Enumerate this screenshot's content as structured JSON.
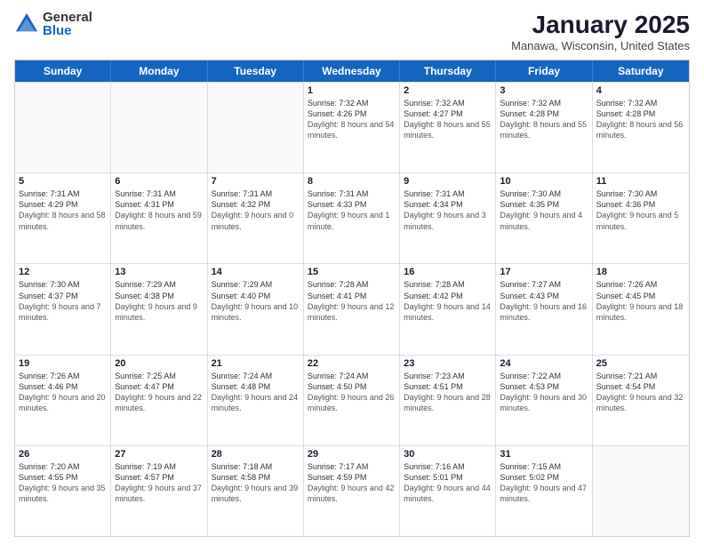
{
  "logo": {
    "general": "General",
    "blue": "Blue"
  },
  "header": {
    "month": "January 2025",
    "location": "Manawa, Wisconsin, United States"
  },
  "weekdays": [
    "Sunday",
    "Monday",
    "Tuesday",
    "Wednesday",
    "Thursday",
    "Friday",
    "Saturday"
  ],
  "rows": [
    [
      {
        "day": "",
        "sunrise": "",
        "sunset": "",
        "daylight": ""
      },
      {
        "day": "",
        "sunrise": "",
        "sunset": "",
        "daylight": ""
      },
      {
        "day": "",
        "sunrise": "",
        "sunset": "",
        "daylight": ""
      },
      {
        "day": "1",
        "sunrise": "Sunrise: 7:32 AM",
        "sunset": "Sunset: 4:26 PM",
        "daylight": "Daylight: 8 hours and 54 minutes."
      },
      {
        "day": "2",
        "sunrise": "Sunrise: 7:32 AM",
        "sunset": "Sunset: 4:27 PM",
        "daylight": "Daylight: 8 hours and 55 minutes."
      },
      {
        "day": "3",
        "sunrise": "Sunrise: 7:32 AM",
        "sunset": "Sunset: 4:28 PM",
        "daylight": "Daylight: 8 hours and 55 minutes."
      },
      {
        "day": "4",
        "sunrise": "Sunrise: 7:32 AM",
        "sunset": "Sunset: 4:28 PM",
        "daylight": "Daylight: 8 hours and 56 minutes."
      }
    ],
    [
      {
        "day": "5",
        "sunrise": "Sunrise: 7:31 AM",
        "sunset": "Sunset: 4:29 PM",
        "daylight": "Daylight: 8 hours and 58 minutes."
      },
      {
        "day": "6",
        "sunrise": "Sunrise: 7:31 AM",
        "sunset": "Sunset: 4:31 PM",
        "daylight": "Daylight: 8 hours and 59 minutes."
      },
      {
        "day": "7",
        "sunrise": "Sunrise: 7:31 AM",
        "sunset": "Sunset: 4:32 PM",
        "daylight": "Daylight: 9 hours and 0 minutes."
      },
      {
        "day": "8",
        "sunrise": "Sunrise: 7:31 AM",
        "sunset": "Sunset: 4:33 PM",
        "daylight": "Daylight: 9 hours and 1 minute."
      },
      {
        "day": "9",
        "sunrise": "Sunrise: 7:31 AM",
        "sunset": "Sunset: 4:34 PM",
        "daylight": "Daylight: 9 hours and 3 minutes."
      },
      {
        "day": "10",
        "sunrise": "Sunrise: 7:30 AM",
        "sunset": "Sunset: 4:35 PM",
        "daylight": "Daylight: 9 hours and 4 minutes."
      },
      {
        "day": "11",
        "sunrise": "Sunrise: 7:30 AM",
        "sunset": "Sunset: 4:36 PM",
        "daylight": "Daylight: 9 hours and 5 minutes."
      }
    ],
    [
      {
        "day": "12",
        "sunrise": "Sunrise: 7:30 AM",
        "sunset": "Sunset: 4:37 PM",
        "daylight": "Daylight: 9 hours and 7 minutes."
      },
      {
        "day": "13",
        "sunrise": "Sunrise: 7:29 AM",
        "sunset": "Sunset: 4:38 PM",
        "daylight": "Daylight: 9 hours and 9 minutes."
      },
      {
        "day": "14",
        "sunrise": "Sunrise: 7:29 AM",
        "sunset": "Sunset: 4:40 PM",
        "daylight": "Daylight: 9 hours and 10 minutes."
      },
      {
        "day": "15",
        "sunrise": "Sunrise: 7:28 AM",
        "sunset": "Sunset: 4:41 PM",
        "daylight": "Daylight: 9 hours and 12 minutes."
      },
      {
        "day": "16",
        "sunrise": "Sunrise: 7:28 AM",
        "sunset": "Sunset: 4:42 PM",
        "daylight": "Daylight: 9 hours and 14 minutes."
      },
      {
        "day": "17",
        "sunrise": "Sunrise: 7:27 AM",
        "sunset": "Sunset: 4:43 PM",
        "daylight": "Daylight: 9 hours and 16 minutes."
      },
      {
        "day": "18",
        "sunrise": "Sunrise: 7:26 AM",
        "sunset": "Sunset: 4:45 PM",
        "daylight": "Daylight: 9 hours and 18 minutes."
      }
    ],
    [
      {
        "day": "19",
        "sunrise": "Sunrise: 7:26 AM",
        "sunset": "Sunset: 4:46 PM",
        "daylight": "Daylight: 9 hours and 20 minutes."
      },
      {
        "day": "20",
        "sunrise": "Sunrise: 7:25 AM",
        "sunset": "Sunset: 4:47 PM",
        "daylight": "Daylight: 9 hours and 22 minutes."
      },
      {
        "day": "21",
        "sunrise": "Sunrise: 7:24 AM",
        "sunset": "Sunset: 4:48 PM",
        "daylight": "Daylight: 9 hours and 24 minutes."
      },
      {
        "day": "22",
        "sunrise": "Sunrise: 7:24 AM",
        "sunset": "Sunset: 4:50 PM",
        "daylight": "Daylight: 9 hours and 26 minutes."
      },
      {
        "day": "23",
        "sunrise": "Sunrise: 7:23 AM",
        "sunset": "Sunset: 4:51 PM",
        "daylight": "Daylight: 9 hours and 28 minutes."
      },
      {
        "day": "24",
        "sunrise": "Sunrise: 7:22 AM",
        "sunset": "Sunset: 4:53 PM",
        "daylight": "Daylight: 9 hours and 30 minutes."
      },
      {
        "day": "25",
        "sunrise": "Sunrise: 7:21 AM",
        "sunset": "Sunset: 4:54 PM",
        "daylight": "Daylight: 9 hours and 32 minutes."
      }
    ],
    [
      {
        "day": "26",
        "sunrise": "Sunrise: 7:20 AM",
        "sunset": "Sunset: 4:55 PM",
        "daylight": "Daylight: 9 hours and 35 minutes."
      },
      {
        "day": "27",
        "sunrise": "Sunrise: 7:19 AM",
        "sunset": "Sunset: 4:57 PM",
        "daylight": "Daylight: 9 hours and 37 minutes."
      },
      {
        "day": "28",
        "sunrise": "Sunrise: 7:18 AM",
        "sunset": "Sunset: 4:58 PM",
        "daylight": "Daylight: 9 hours and 39 minutes."
      },
      {
        "day": "29",
        "sunrise": "Sunrise: 7:17 AM",
        "sunset": "Sunset: 4:59 PM",
        "daylight": "Daylight: 9 hours and 42 minutes."
      },
      {
        "day": "30",
        "sunrise": "Sunrise: 7:16 AM",
        "sunset": "Sunset: 5:01 PM",
        "daylight": "Daylight: 9 hours and 44 minutes."
      },
      {
        "day": "31",
        "sunrise": "Sunrise: 7:15 AM",
        "sunset": "Sunset: 5:02 PM",
        "daylight": "Daylight: 9 hours and 47 minutes."
      },
      {
        "day": "",
        "sunrise": "",
        "sunset": "",
        "daylight": ""
      }
    ]
  ]
}
